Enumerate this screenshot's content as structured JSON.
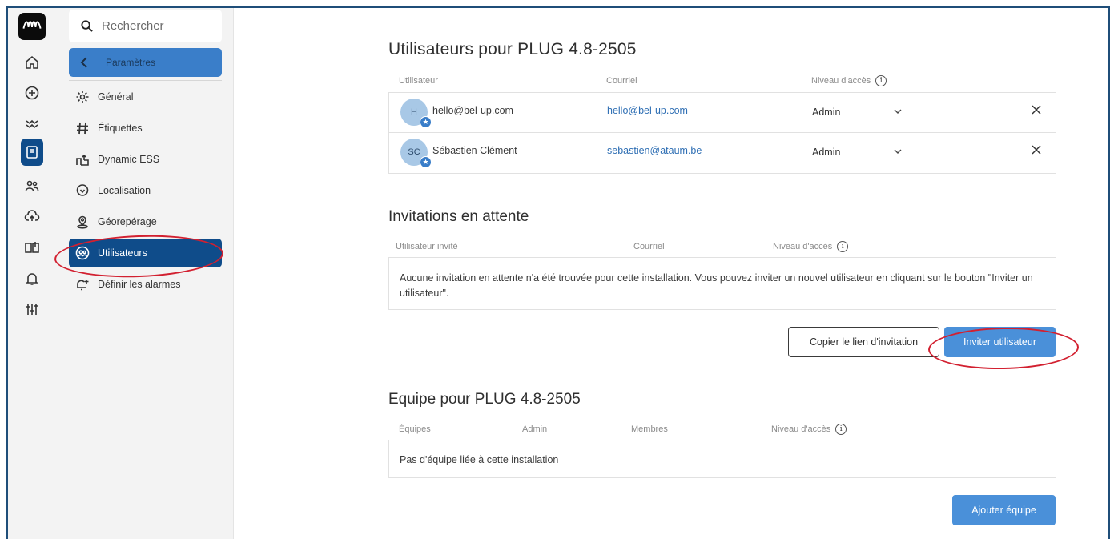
{
  "search": {
    "placeholder": "Rechercher"
  },
  "back": {
    "label": "Paramètres"
  },
  "nav": [
    {
      "label": "Général",
      "icon": "gear-icon"
    },
    {
      "label": "Étiquettes",
      "icon": "hashtag-icon"
    },
    {
      "label": "Dynamic ESS",
      "icon": "ess-icon"
    },
    {
      "label": "Localisation",
      "icon": "location-pin-icon"
    },
    {
      "label": "Géorepérage",
      "icon": "geofence-icon"
    },
    {
      "label": "Utilisateurs",
      "icon": "users-icon"
    },
    {
      "label": "Définir les alarmes",
      "icon": "bell-plus-icon"
    }
  ],
  "users_section": {
    "title": "Utilisateurs pour PLUG 4.8-2505",
    "headers": {
      "user": "Utilisateur",
      "email": "Courriel",
      "level": "Niveau d'accès"
    },
    "rows": [
      {
        "initials": "H",
        "name": "hello@bel-up.com",
        "email": "hello@bel-up.com",
        "level": "Admin"
      },
      {
        "initials": "SC",
        "name": "Sébastien Clément",
        "email": "sebastien@ataum.be",
        "level": "Admin"
      }
    ]
  },
  "invitations": {
    "title": "Invitations en attente",
    "headers": {
      "user": "Utilisateur invité",
      "email": "Courriel",
      "level": "Niveau d'accès"
    },
    "empty_message": "Aucune invitation en attente n'a été trouvée pour cette installation. Vous pouvez inviter un nouvel utilisateur en cliquant sur le bouton \"Inviter un utilisateur\".",
    "copy_link_label": "Copier le lien d'invitation",
    "invite_label": "Inviter utilisateur"
  },
  "teams": {
    "title": "Equipe pour PLUG 4.8-2505",
    "headers": {
      "teams": "Équipes",
      "admin": "Admin",
      "members": "Membres",
      "level": "Niveau d'accès"
    },
    "empty_message": "Pas d'équipe liée à cette installation",
    "add_label": "Ajouter équipe"
  },
  "colors": {
    "accent": "#4a90d9",
    "active_nav": "#0f4c8a",
    "annotation": "#d22030"
  }
}
